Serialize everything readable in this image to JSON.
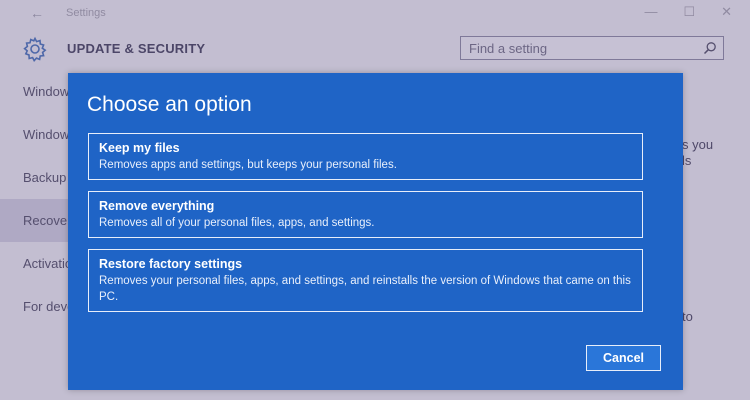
{
  "window": {
    "title": "Settings",
    "back_glyph": "←",
    "controls": [
      "—",
      "☐",
      "✕"
    ]
  },
  "header": {
    "icon": "gear-icon",
    "section_title": "UPDATE & SECURITY",
    "search_placeholder": "Find a setting",
    "search_icon": "search-icon"
  },
  "sidebar": {
    "items": [
      {
        "label": "Windows Update"
      },
      {
        "label": "Windows Defender"
      },
      {
        "label": "Backup"
      },
      {
        "label": "Recovery"
      },
      {
        "label": "Activation"
      },
      {
        "label": "For developers"
      }
    ]
  },
  "background_text": {
    "fragments": [
      "s you",
      "ls",
      "to"
    ]
  },
  "dialog": {
    "title": "Choose an option",
    "options": [
      {
        "title": "Keep my files",
        "description": "Removes apps and settings, but keeps your personal files."
      },
      {
        "title": "Remove everything",
        "description": "Removes all of your personal files, apps, and settings."
      },
      {
        "title": "Restore factory settings",
        "description": "Removes your personal files, apps, and settings, and reinstalls the version of Windows that came on this PC."
      }
    ],
    "cancel_label": "Cancel"
  },
  "colors": {
    "dialog_bg": "#1f64c6",
    "cancel_bg": "#2a76d9",
    "border": "#e7eefa",
    "sidebar_selected": "#d4d1e2"
  }
}
